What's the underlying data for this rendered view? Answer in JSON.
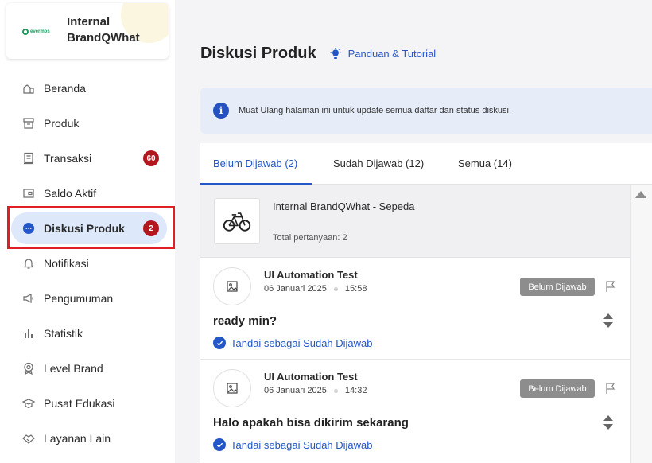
{
  "brand": {
    "name": "Internal BrandQWhat",
    "logo_text": "evermos"
  },
  "nav": [
    {
      "label": "Beranda",
      "icon": "home-icon"
    },
    {
      "label": "Produk",
      "icon": "box-icon"
    },
    {
      "label": "Transaksi",
      "icon": "receipt-icon",
      "badge": "60"
    },
    {
      "label": "Saldo Aktif",
      "icon": "wallet-icon"
    },
    {
      "label": "Diskusi Produk",
      "icon": "chat-icon",
      "badge": "2",
      "active": true
    },
    {
      "label": "Notifikasi",
      "icon": "bell-icon"
    },
    {
      "label": "Pengumuman",
      "icon": "megaphone-icon"
    },
    {
      "label": "Statistik",
      "icon": "bar-chart-icon"
    },
    {
      "label": "Level Brand",
      "icon": "medal-icon"
    },
    {
      "label": "Pusat Edukasi",
      "icon": "graduation-cap-icon"
    },
    {
      "label": "Layanan Lain",
      "icon": "handshake-icon"
    }
  ],
  "header": {
    "title": "Diskusi Produk",
    "guide_label": "Panduan & Tutorial"
  },
  "banner": {
    "text": "Muat Ulang halaman ini untuk update semua daftar dan status diskusi."
  },
  "tabs": [
    {
      "label": "Belum Dijawab (2)",
      "active": true
    },
    {
      "label": "Sudah Dijawab (12)"
    },
    {
      "label": "Semua (14)"
    }
  ],
  "product": {
    "name": "Internal BrandQWhat - Sepeda",
    "count": "Total pertanyaan: 2"
  },
  "questions": [
    {
      "asker": "UI Automation Test",
      "date": "06 Januari 2025",
      "time": "15:58",
      "status": "Belum Dijawab",
      "text": "ready min?",
      "action": "Tandai sebagai Sudah Dijawab"
    },
    {
      "asker": "UI Automation Test",
      "date": "06 Januari 2025",
      "time": "14:32",
      "status": "Belum Dijawab",
      "text": "Halo apakah bisa dikirim sekarang",
      "action": "Tandai sebagai Sudah Dijawab"
    }
  ],
  "colors": {
    "accent": "#2356c6",
    "badge": "#b3171d",
    "highlight": "#e01f25",
    "active_bg": "#dde8fb"
  }
}
